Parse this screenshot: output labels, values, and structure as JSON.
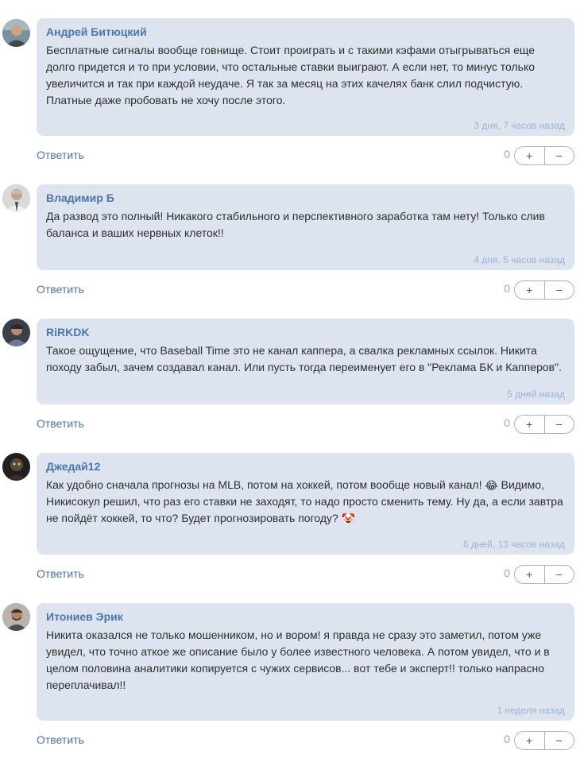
{
  "comments": [
    {
      "author": "Андрей Битюцкий",
      "text": "Бесплатные сигналы вообще говнище. Стоит проиграть и с такими кэфами отыгрываться еще долго придется и то при условии, что остальные ставки выиграют. А если нет, то минус только увеличится и так при каждой неудаче. Я так за месяц на этих качелях банк слил подчистую. Платные даже пробовать не хочу после этого.",
      "time": "3 дня, 7 часов назад",
      "reply": "Ответить",
      "count": "0",
      "plus": "+",
      "minus": "−"
    },
    {
      "author": "Владимир Б",
      "text": "Да развод это полный! Никакого стабильного и перспективного заработка там нету! Только слив баланса и ваших нервных клеток!!",
      "time": "4 дня, 5 часов назад",
      "reply": "Ответить",
      "count": "0",
      "plus": "+",
      "minus": "−"
    },
    {
      "author": "RiRKDK",
      "text": "Такое ощущение, что Baseball Time это не канал каппера, а свалка рекламных ссылок. Никита походу забыл, зачем создавал канал. Или пусть тогда переименует его в \"Реклама БК и Капперов\".",
      "time": "5 дней назад",
      "reply": "Ответить",
      "count": "0",
      "plus": "+",
      "minus": "−"
    },
    {
      "author": "Джедай12",
      "text_part1": "Как удобно сначала прогнозы на MLB, потом на хоккей, потом вообще новый канал!",
      "emoji1": "😂",
      "text_part2": "Видимо, Никисокул решил, что раз его ставки не заходят, то надо просто сменить тему. Ну да, а если завтра не пойдёт хоккей, то что? Будет прогнозировать погоду?",
      "emoji2": "🤡",
      "time": "6 дней, 13 часов назад",
      "reply": "Ответить",
      "count": "0",
      "plus": "+",
      "minus": "−"
    },
    {
      "author": "Итониев Эрик",
      "text": "Никита оказался не только мошенником, но и вором! я правда не сразу это заметил, потом уже увидел, что точно аткое же описание было у более известного человека. А потом увидел, что и в целом половина аналитики копируется с чужих сервисов... вот тебе и эксперт!! только напрасно переплачивал!!",
      "time": "1 неделя назад",
      "reply": "Ответить",
      "count": "0",
      "plus": "+",
      "minus": "−"
    }
  ]
}
